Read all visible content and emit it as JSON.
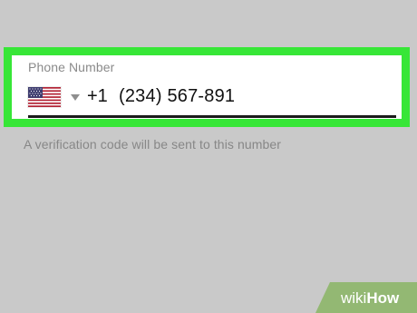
{
  "phone_field": {
    "label": "Phone Number",
    "country_icon": "us-flag-icon",
    "country_code": "+1",
    "number": "(234) 567-891"
  },
  "helper_text": "A verification code will be sent to this number",
  "watermark": {
    "text": "wikiHow"
  },
  "colors": {
    "highlight": "#37e637",
    "background": "#c9c9c9"
  }
}
